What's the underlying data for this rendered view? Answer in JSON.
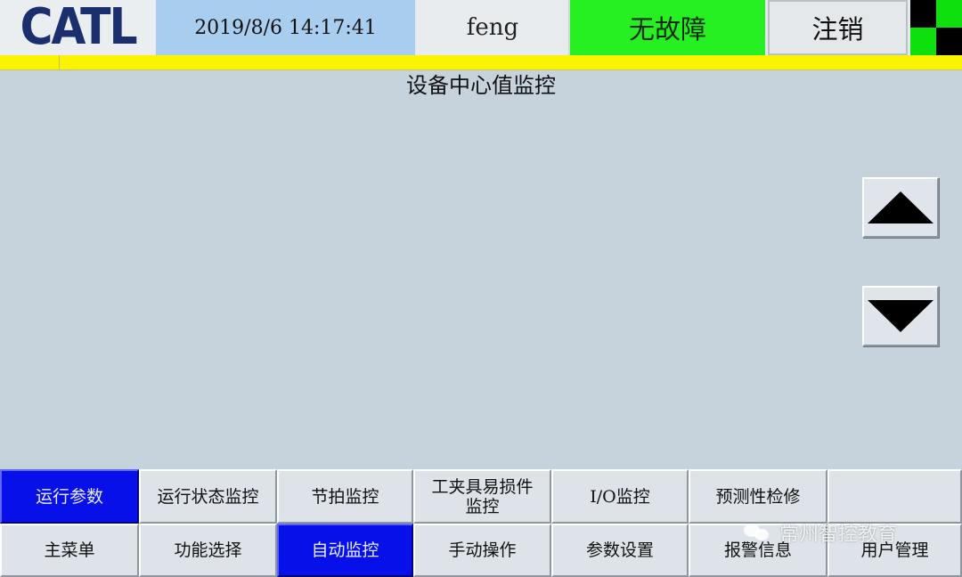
{
  "header": {
    "logo_text": "CATL",
    "datetime": "2019/8/6  14:17:41",
    "user": "feng",
    "status": "无故障",
    "logout_label": "注销"
  },
  "main": {
    "title": "设备中心值监控"
  },
  "sub_tabs": [
    {
      "label": "运行参数",
      "active": true
    },
    {
      "label": "运行状态监控",
      "active": false
    },
    {
      "label": "节拍监控",
      "active": false
    },
    {
      "label": "工夹具易损件\n监控",
      "active": false
    },
    {
      "label": "I/O监控",
      "active": false
    },
    {
      "label": "预测性检修",
      "active": false
    },
    {
      "label": "",
      "active": false
    }
  ],
  "nav_tabs": [
    {
      "label": "主菜单",
      "active": false
    },
    {
      "label": "功能选择",
      "active": false
    },
    {
      "label": "自动监控",
      "active": true
    },
    {
      "label": "手动操作",
      "active": false
    },
    {
      "label": "参数设置",
      "active": false
    },
    {
      "label": "报警信息",
      "active": false
    },
    {
      "label": "用户管理",
      "active": false
    }
  ],
  "watermark": {
    "text": "常州智控教育",
    "icon": "wechat-icon"
  },
  "colors": {
    "status_ok": "#26f022",
    "active_tab": "#0710e8",
    "alarm_bar": "#fbf400",
    "background": "#c6d3dc"
  }
}
